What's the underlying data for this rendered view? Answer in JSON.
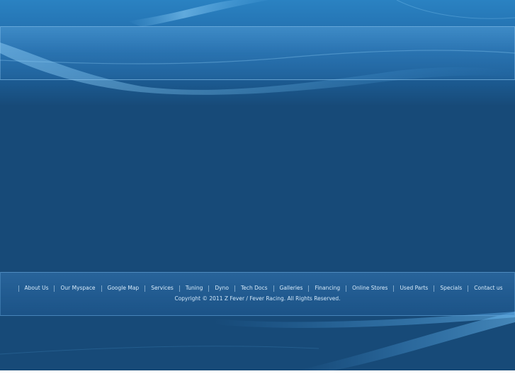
{
  "colors": {
    "background": "#174a78",
    "header_top": "#2a82c2",
    "nav_text": "#d8ebfb"
  },
  "footer": {
    "nav": [
      {
        "id": "about-us",
        "label": "About Us"
      },
      {
        "id": "our-myspace",
        "label": "Our Myspace"
      },
      {
        "id": "google-map",
        "label": "Google Map"
      },
      {
        "id": "services",
        "label": "Services"
      },
      {
        "id": "tuning",
        "label": "Tuning"
      },
      {
        "id": "dyno",
        "label": "Dyno"
      },
      {
        "id": "tech-docs",
        "label": "Tech Docs"
      },
      {
        "id": "galleries",
        "label": "Galleries"
      },
      {
        "id": "financing",
        "label": "Financing"
      },
      {
        "id": "online-stores",
        "label": "Online Stores"
      },
      {
        "id": "used-parts",
        "label": "Used Parts"
      },
      {
        "id": "specials",
        "label": "Specials"
      },
      {
        "id": "contact-us",
        "label": "Contact us"
      }
    ],
    "copyright": "Copyright © 2011  Z Fever / Fever Racing. All Rights Reserved."
  }
}
